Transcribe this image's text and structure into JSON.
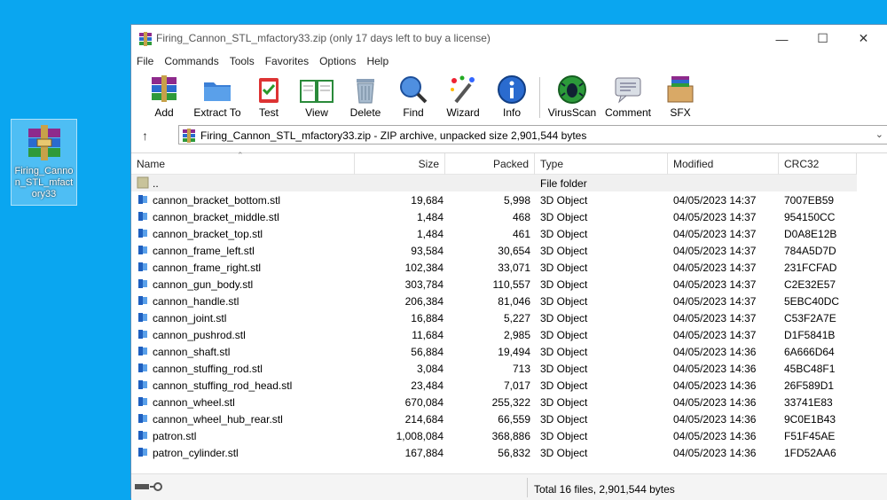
{
  "desktop_icon": {
    "label": "Firing_Cannon_STL_mfactory33"
  },
  "window": {
    "title": "Firing_Cannon_STL_mfactory33.zip (only 17 days left to buy a license)",
    "minimize": "—",
    "maximize": "☐",
    "close": "✕"
  },
  "menu": [
    "File",
    "Commands",
    "Tools",
    "Favorites",
    "Options",
    "Help"
  ],
  "toolbar": {
    "add": "Add",
    "extract": "Extract To",
    "test": "Test",
    "view": "View",
    "delete": "Delete",
    "find": "Find",
    "wizard": "Wizard",
    "info": "Info",
    "virusscan": "VirusScan",
    "comment": "Comment",
    "sfx": "SFX"
  },
  "address": {
    "up": "↑",
    "path": "Firing_Cannon_STL_mfactory33.zip - ZIP archive, unpacked size 2,901,544 bytes",
    "dropdown": "⌄"
  },
  "columns": {
    "name": "Name",
    "size": "Size",
    "packed": "Packed",
    "type": "Type",
    "modified": "Modified",
    "crc": "CRC32"
  },
  "parent_row": {
    "name": "..",
    "type": "File folder"
  },
  "files": [
    {
      "name": "cannon_bracket_bottom.stl",
      "size": "19,684",
      "packed": "5,998",
      "type": "3D Object",
      "modified": "04/05/2023 14:37",
      "crc": "7007EB59"
    },
    {
      "name": "cannon_bracket_middle.stl",
      "size": "1,484",
      "packed": "468",
      "type": "3D Object",
      "modified": "04/05/2023 14:37",
      "crc": "954150CC"
    },
    {
      "name": "cannon_bracket_top.stl",
      "size": "1,484",
      "packed": "461",
      "type": "3D Object",
      "modified": "04/05/2023 14:37",
      "crc": "D0A8E12B"
    },
    {
      "name": "cannon_frame_left.stl",
      "size": "93,584",
      "packed": "30,654",
      "type": "3D Object",
      "modified": "04/05/2023 14:37",
      "crc": "784A5D7D"
    },
    {
      "name": "cannon_frame_right.stl",
      "size": "102,384",
      "packed": "33,071",
      "type": "3D Object",
      "modified": "04/05/2023 14:37",
      "crc": "231FCFAD"
    },
    {
      "name": "cannon_gun_body.stl",
      "size": "303,784",
      "packed": "110,557",
      "type": "3D Object",
      "modified": "04/05/2023 14:37",
      "crc": "C2E32E57"
    },
    {
      "name": "cannon_handle.stl",
      "size": "206,384",
      "packed": "81,046",
      "type": "3D Object",
      "modified": "04/05/2023 14:37",
      "crc": "5EBC40DC"
    },
    {
      "name": "cannon_joint.stl",
      "size": "16,884",
      "packed": "5,227",
      "type": "3D Object",
      "modified": "04/05/2023 14:37",
      "crc": "C53F2A7E"
    },
    {
      "name": "cannon_pushrod.stl",
      "size": "11,684",
      "packed": "2,985",
      "type": "3D Object",
      "modified": "04/05/2023 14:37",
      "crc": "D1F5841B"
    },
    {
      "name": "cannon_shaft.stl",
      "size": "56,884",
      "packed": "19,494",
      "type": "3D Object",
      "modified": "04/05/2023 14:36",
      "crc": "6A666D64"
    },
    {
      "name": "cannon_stuffing_rod.stl",
      "size": "3,084",
      "packed": "713",
      "type": "3D Object",
      "modified": "04/05/2023 14:36",
      "crc": "45BC48F1"
    },
    {
      "name": "cannon_stuffing_rod_head.stl",
      "size": "23,484",
      "packed": "7,017",
      "type": "3D Object",
      "modified": "04/05/2023 14:36",
      "crc": "26F589D1"
    },
    {
      "name": "cannon_wheel.stl",
      "size": "670,084",
      "packed": "255,322",
      "type": "3D Object",
      "modified": "04/05/2023 14:36",
      "crc": "33741E83"
    },
    {
      "name": "cannon_wheel_hub_rear.stl",
      "size": "214,684",
      "packed": "66,559",
      "type": "3D Object",
      "modified": "04/05/2023 14:36",
      "crc": "9C0E1B43"
    },
    {
      "name": "patron.stl",
      "size": "1,008,084",
      "packed": "368,886",
      "type": "3D Object",
      "modified": "04/05/2023 14:36",
      "crc": "F51F45AE"
    },
    {
      "name": "patron_cylinder.stl",
      "size": "167,884",
      "packed": "56,832",
      "type": "3D Object",
      "modified": "04/05/2023 14:36",
      "crc": "1FD52AA6"
    }
  ],
  "status": {
    "summary": "Total 16 files, 2,901,544 bytes"
  }
}
